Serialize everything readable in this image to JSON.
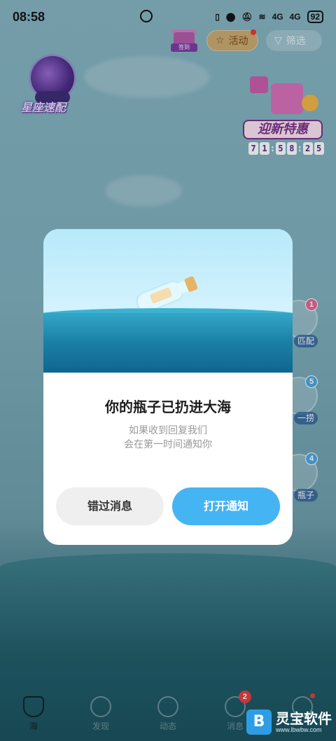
{
  "status_bar": {
    "time": "08:58",
    "network_1": "4G",
    "network_2": "4G",
    "battery": "92"
  },
  "top_bar": {
    "gift_label": "签到",
    "activity_label": "活动",
    "filter_label": "筛选"
  },
  "constellation": {
    "label": "星座速配"
  },
  "promo": {
    "title": "迎新特惠",
    "timer": [
      "7",
      "1",
      "5",
      "8",
      "2",
      "5"
    ]
  },
  "side_items": [
    {
      "label": "匹配",
      "badge": "1",
      "badge_color": "#e5668f"
    },
    {
      "label": "一捞",
      "badge": "5",
      "badge_color": "#4aa8e0"
    },
    {
      "label": "瓶子",
      "badge": "4",
      "badge_color": "#4aa8e0"
    }
  ],
  "dialog": {
    "title": "你的瓶子已扔进大海",
    "subtitle_line1": "如果收到回复我们",
    "subtitle_line2": "会在第一时间通知你",
    "miss_button": "错过消息",
    "open_button": "打开通知"
  },
  "bottom_nav": {
    "items": [
      {
        "label": "海",
        "icon": "bottle-icon",
        "active": true
      },
      {
        "label": "发现",
        "icon": "planet-icon",
        "active": false
      },
      {
        "label": "动态",
        "icon": "star-icon",
        "active": false
      },
      {
        "label": "消息",
        "icon": "chat-icon",
        "active": false,
        "badge": "2"
      },
      {
        "label": "",
        "icon": "profile-icon",
        "active": false
      }
    ]
  },
  "watermark": {
    "text": "灵宝软件",
    "url": "www.lbwbw.com"
  }
}
